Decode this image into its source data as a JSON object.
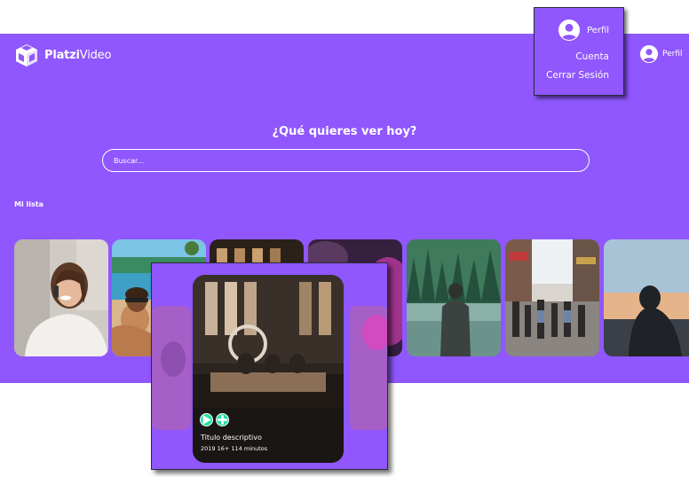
{
  "app": {
    "logo_bold": "Platzi",
    "logo_light": "Video",
    "header_profile_label": "Perfil"
  },
  "hero": {
    "title": "¿Qué quieres ver hoy?",
    "search_placeholder": "Buscar..."
  },
  "section": {
    "title": "Mi lista"
  },
  "dropdown": {
    "profile_label": "Perfil",
    "account_label": "Cuenta",
    "logout_label": "Cerrar Sesión"
  },
  "popup_card": {
    "title": "Titulo descriptivo",
    "meta": "2019 16+ 114 minutos",
    "play_icon": "play-icon",
    "add_icon": "plus-icon"
  },
  "colors": {
    "brand_purple": "#8f57fd",
    "accent_green": "#26e0a6"
  }
}
